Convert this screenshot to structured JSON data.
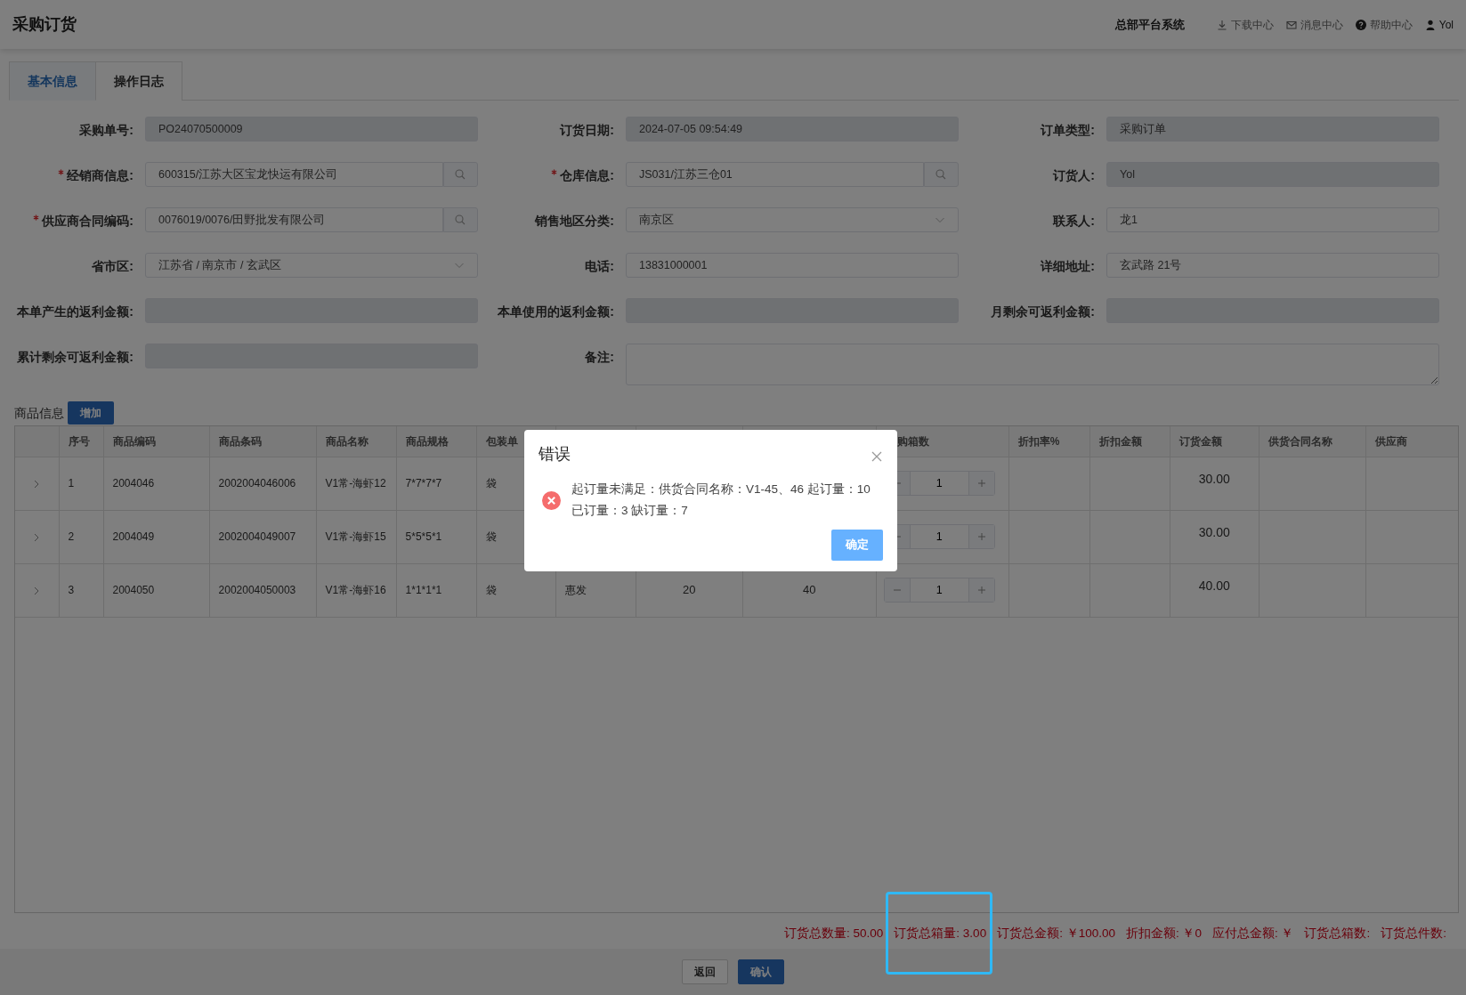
{
  "header": {
    "title": "采购订货",
    "system": "总部平台系统",
    "links": [
      {
        "label": "下载中心"
      },
      {
        "label": "消息中心"
      },
      {
        "label": "帮助中心"
      },
      {
        "label": "Yol"
      }
    ]
  },
  "tabs": [
    {
      "label": "基本信息",
      "selected": true
    },
    {
      "label": "操作日志",
      "selected": false
    }
  ],
  "form": [
    {
      "label": "采购单号:",
      "kind": "text",
      "disabled": true,
      "value": "PO24070500009"
    },
    {
      "label": "订货日期:",
      "kind": "text",
      "disabled": true,
      "value": "2024-07-05 09:54:49"
    },
    {
      "label": "订单类型:",
      "kind": "text",
      "disabled": true,
      "value": "采购订单"
    },
    {
      "label": "经销商信息:",
      "kind": "search",
      "required": true,
      "disabled": false,
      "value": "600315/江苏大区宝龙快运有限公司"
    },
    {
      "label": "仓库信息:",
      "kind": "search",
      "required": true,
      "disabled": false,
      "value": "JS031/江苏三仓01"
    },
    {
      "label": "订货人:",
      "kind": "text",
      "disabled": true,
      "value": "Yol"
    },
    {
      "label": "供应商合同编码:",
      "kind": "search",
      "required": true,
      "disabled": false,
      "value": "0076019/0076/田野批发有限公司"
    },
    {
      "label": "销售地区分类:",
      "kind": "select",
      "disabled": false,
      "value": "南京区"
    },
    {
      "label": "联系人:",
      "kind": "text",
      "disabled": false,
      "value": "龙1"
    },
    {
      "label": "省市区:",
      "kind": "select",
      "disabled": false,
      "value": "江苏省 / 南京市 / 玄武区"
    },
    {
      "label": "电话:",
      "kind": "text",
      "disabled": false,
      "value": "13831000001"
    },
    {
      "label": "详细地址:",
      "kind": "text",
      "disabled": false,
      "value": "玄武路 21号"
    },
    {
      "label": "本单产生的返利金额:",
      "kind": "text",
      "disabled": true
    },
    {
      "label": "本单使用的返利金额:",
      "kind": "text",
      "disabled": true
    },
    {
      "label": "月剩余可返利金额:",
      "kind": "text",
      "disabled": true
    },
    {
      "label": "累计剩余可返利金额:",
      "kind": "text",
      "disabled": true
    },
    {
      "label": "备注:",
      "kind": "textarea",
      "disabled": false
    }
  ],
  "goods": {
    "title": "商品信息",
    "add_button": "增加"
  },
  "table": {
    "columns": [
      {
        "kind": "expander"
      },
      {
        "kind": "text",
        "label": "序号"
      },
      {
        "kind": "text",
        "label": "商品编码"
      },
      {
        "kind": "text",
        "label": "商品条码"
      },
      {
        "kind": "text",
        "label": "商品名称"
      },
      {
        "kind": "text",
        "label": "商品规格"
      },
      {
        "kind": "text",
        "label": "包装单"
      },
      {
        "kind": "text"
      },
      {
        "kind": "number"
      },
      {
        "kind": "number"
      },
      {
        "kind": "stepper",
        "label": "购箱数"
      },
      {
        "kind": "text",
        "label": "折扣率%"
      },
      {
        "kind": "text",
        "label": "折扣金额"
      },
      {
        "kind": "amount",
        "label": "订货金额"
      },
      {
        "kind": "text",
        "label": "供货合同名称"
      },
      {
        "kind": "text",
        "label": "供应商"
      }
    ],
    "rows": [
      {
        "expanded": false,
        "cells": [
          "",
          "1",
          "2004046",
          "2002004046006",
          "V1常-海虾12",
          "7*7*7*7",
          "袋",
          null,
          null,
          null,
          "1",
          null,
          null,
          "30.00",
          null,
          null
        ]
      },
      {
        "expanded": false,
        "cells": [
          "",
          "2",
          "2004049",
          "2002004049007",
          "V1常-海虾15",
          "5*5*5*1",
          "袋",
          null,
          null,
          null,
          "1",
          null,
          null,
          "30.00",
          null,
          null
        ]
      },
      {
        "expanded": false,
        "cells": [
          "",
          "3",
          "2004050",
          "2002004050003",
          "V1常-海虾16",
          "1*1*1*1",
          "袋",
          "惠发",
          "20",
          "40",
          "1",
          null,
          null,
          "40.00",
          null,
          null
        ]
      }
    ]
  },
  "totals": [
    {
      "text": "订货总数量: 50.00"
    },
    {
      "text": "订货总箱量: 3.00",
      "highlighted": true
    },
    {
      "text": "订货总金额: ￥100.00"
    },
    {
      "text": "折扣金额: ￥0"
    },
    {
      "text": "应付总金额: ￥"
    },
    {
      "text": "订货总箱数:"
    },
    {
      "text": "订货总件数:"
    }
  ],
  "footer_buttons": [
    {
      "label": "返回",
      "kind": "secondary"
    },
    {
      "label": "确认",
      "kind": "primary"
    }
  ],
  "dialog": {
    "title": "错误",
    "lines": [
      "起订量未满足：供货合同名称：V1-45、46 起订量：10",
      "已订量：3 缺订量：7"
    ],
    "button": "确定"
  }
}
